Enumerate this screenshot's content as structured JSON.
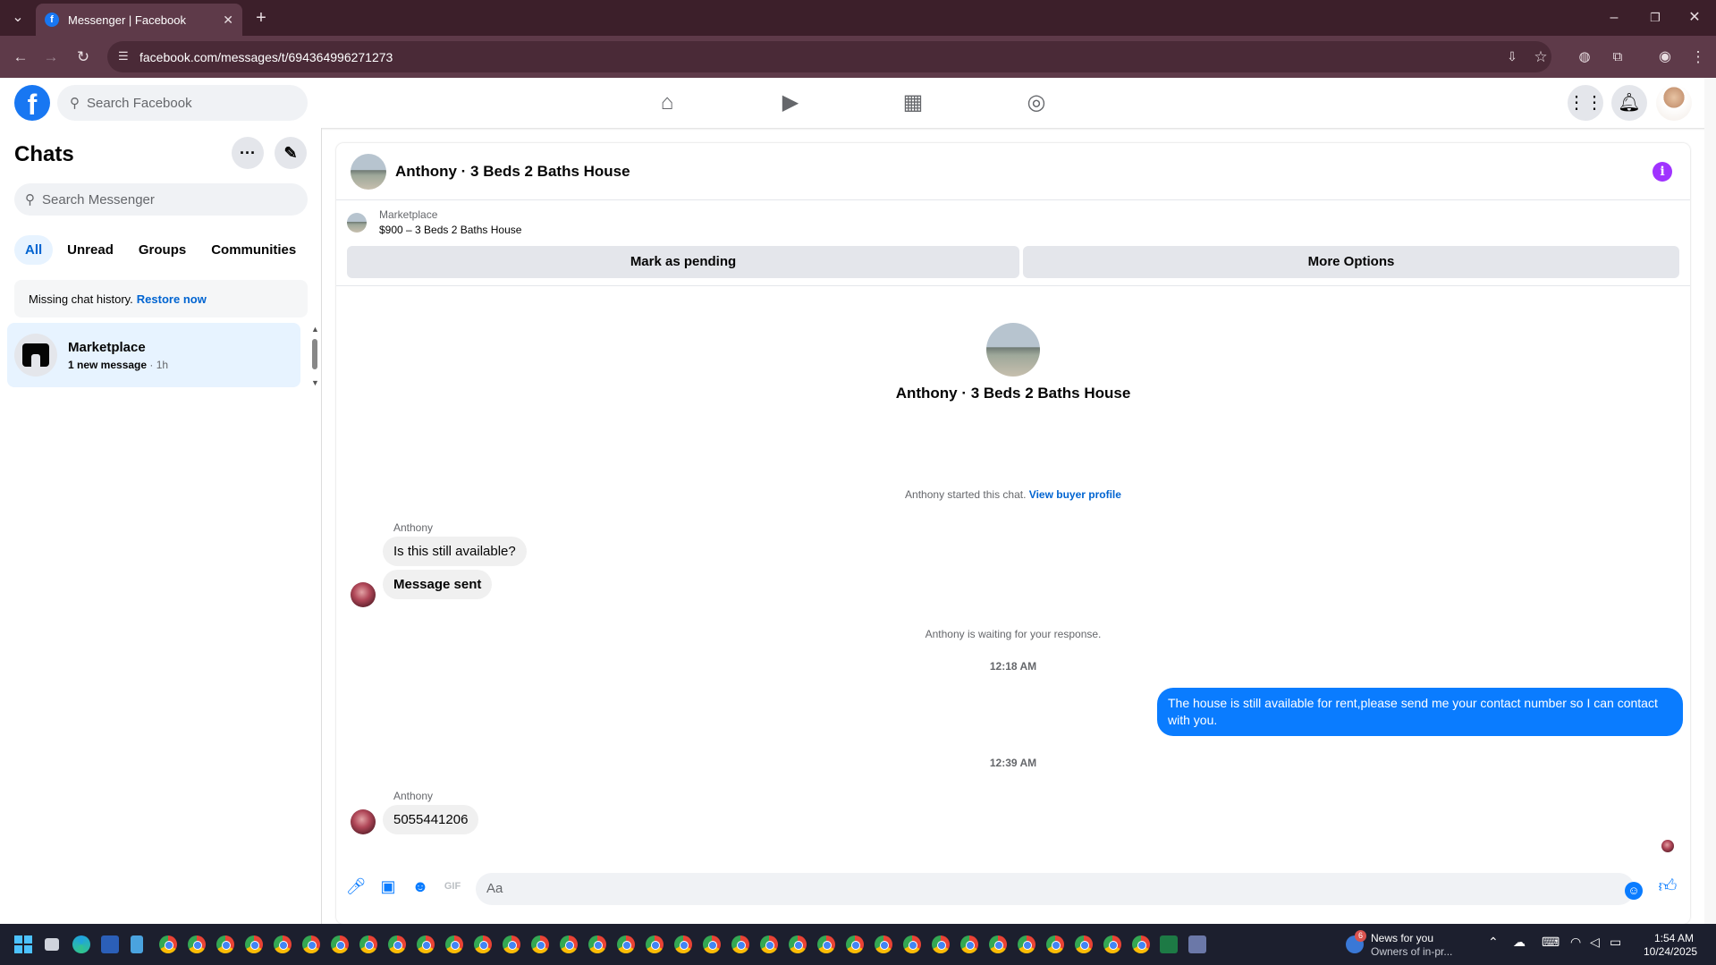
{
  "browser": {
    "tab_title": "Messenger | Facebook",
    "url": "facebook.com/messages/t/694364996271273"
  },
  "fb": {
    "search_placeholder": "Search Facebook"
  },
  "sidebar": {
    "title": "Chats",
    "search_placeholder": "Search Messenger",
    "filters": [
      "All",
      "Unread",
      "Groups",
      "Communities"
    ],
    "restore_text": "Missing chat history.",
    "restore_link": "Restore now",
    "chat": {
      "name": "Marketplace",
      "subtitle": "1 new message",
      "time": " · 1h"
    }
  },
  "conversation": {
    "header_name": "Anthony · 3 Beds 2 Baths House",
    "marketplace_label": "Marketplace",
    "listing": "$900 – 3 Beds 2 Baths House",
    "mark_pending": "Mark as pending",
    "more_options": "More Options",
    "center_name": "Anthony · 3 Beds 2 Baths House",
    "started_text": "Anthony started this chat.",
    "view_profile": "View buyer profile",
    "sender_name": "Anthony",
    "msg1": "Is this still available?",
    "msg2": "Message sent",
    "waiting_text": "Anthony is waiting for your response.",
    "time1": "12:18 AM",
    "outgoing": "The house is still available for rent,please send me your contact number so I can contact with you.",
    "time2": "12:39 AM",
    "msg3": "5055441206",
    "composer_placeholder": "Aa"
  },
  "taskbar": {
    "news_badge": "6",
    "news_title": "News for you",
    "news_sub": "Owners of in-pr...",
    "time": "1:54 AM",
    "date": "10/24/2025"
  },
  "colors": {
    "accent": "#0a7cff",
    "fb_blue": "#1877f2",
    "titlebar": "#3c1f2a"
  }
}
